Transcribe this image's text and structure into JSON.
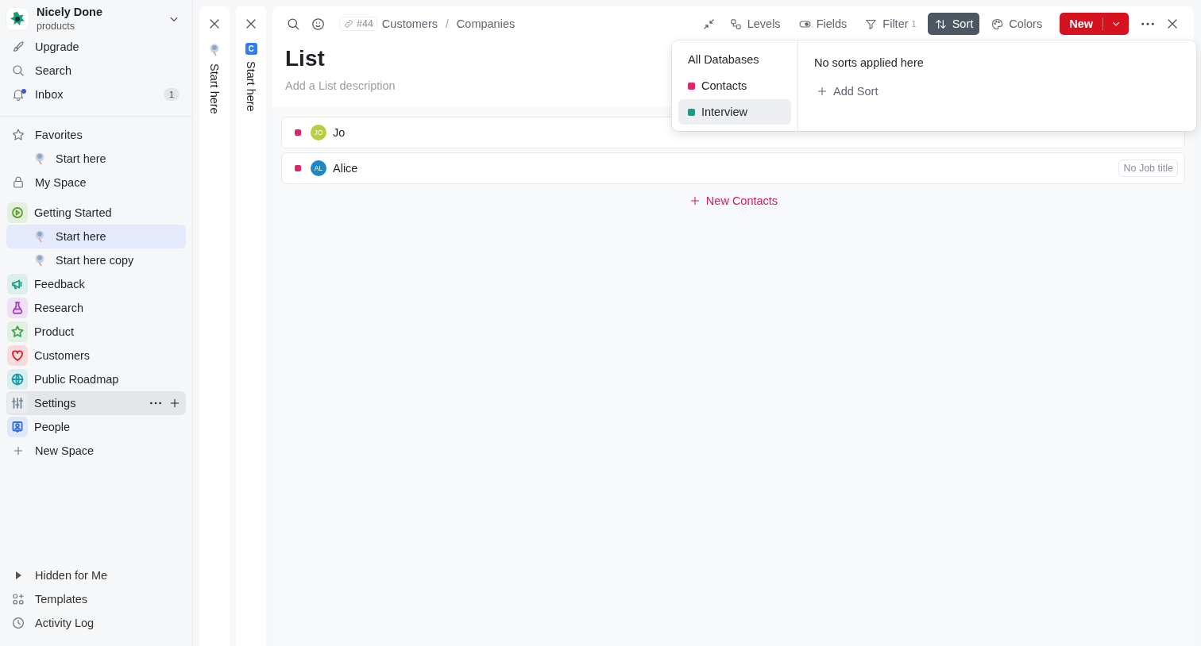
{
  "workspace": {
    "name": "Nicely Done",
    "subtitle": "products"
  },
  "nav": [
    {
      "label": "Upgrade"
    },
    {
      "label": "Search"
    },
    {
      "label": "Inbox",
      "badge": "1",
      "unread": true
    }
  ],
  "favorites": {
    "label": "Favorites",
    "children": [
      {
        "label": "Start here",
        "selected": false
      }
    ]
  },
  "spaces": [
    {
      "label": "My Space",
      "kind": "private"
    },
    {
      "label": "Getting Started",
      "kind": "space",
      "color": "#5a9e2f",
      "hovered": false,
      "children": [
        {
          "label": "Start here",
          "selected": true
        },
        {
          "label": "Start here copy",
          "selected": false
        }
      ]
    },
    {
      "label": "Feedback",
      "kind": "space",
      "color": "#1f9a85",
      "hovered": false
    },
    {
      "label": "Research",
      "kind": "space",
      "color": "#a43fc2",
      "hovered": false
    },
    {
      "label": "Product",
      "kind": "space",
      "color": "#3fa34d",
      "hovered": false
    },
    {
      "label": "Customers",
      "kind": "space",
      "color": "#d2232a",
      "hovered": false
    },
    {
      "label": "Public Roadmap",
      "kind": "space",
      "color": "#1b9aa6",
      "hovered": false
    },
    {
      "label": "Settings",
      "kind": "space",
      "color": "#7b8a99",
      "hovered": true
    },
    {
      "label": "People",
      "kind": "space",
      "color": "#2f6fd6",
      "hovered": false
    },
    {
      "label": "New Space",
      "kind": "add"
    }
  ],
  "footer": [
    {
      "label": "Hidden for Me",
      "kind": "toggle"
    },
    {
      "label": "Templates",
      "kind": "link"
    },
    {
      "label": "Activity Log",
      "kind": "link"
    }
  ],
  "strips": [
    {
      "label": "Start here",
      "kind": "page"
    },
    {
      "label": "Start here",
      "kind": "database",
      "badge": "C"
    }
  ],
  "main": {
    "ref": "#44",
    "breadcrumb": [
      "Customers",
      "Companies"
    ],
    "breadcrumb_separator": "/",
    "toolbar": [
      {
        "label": "Levels",
        "active": false
      },
      {
        "label": "Fields",
        "active": false
      },
      {
        "label": "Filter",
        "count": "1",
        "active": false
      },
      {
        "label": "Sort",
        "active": true
      },
      {
        "label": "Colors",
        "active": false
      }
    ],
    "new_button": "New",
    "title": "List",
    "description_placeholder": "Add a List description",
    "rows": [
      {
        "name": "Jo",
        "initials": "JO",
        "color": "#b5cf3f"
      },
      {
        "name": "Alice",
        "initials": "AL",
        "color": "#1e88c7",
        "job_title": "No Job title"
      }
    ],
    "add_label": "New Contacts"
  },
  "sort_popup": {
    "databases": [
      {
        "label": "All Databases",
        "selected": false
      },
      {
        "label": "Contacts",
        "color": "#e2245f",
        "selected": false
      },
      {
        "label": "Interview",
        "color": "#1a9985",
        "selected": true
      }
    ],
    "empty": "No sorts applied here",
    "add": "Add Sort"
  }
}
